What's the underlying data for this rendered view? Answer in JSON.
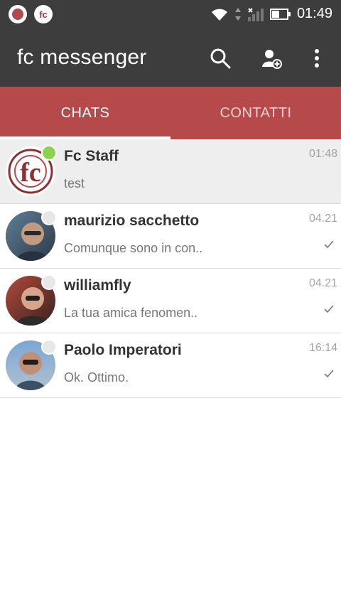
{
  "status_bar": {
    "time": "01:49"
  },
  "app_bar": {
    "title": "fc messenger",
    "actions": [
      "search-icon",
      "add-contact-icon",
      "overflow-menu-icon"
    ]
  },
  "tabs": [
    {
      "label": "CHATS",
      "active": true
    },
    {
      "label": "CONTATTI",
      "active": false
    }
  ],
  "colors": {
    "appbar": "#3d3d3d",
    "tabs": "#b64a4b",
    "online": "#8bd34e",
    "offline": "#e7e7e7"
  },
  "chats": [
    {
      "name": "Fc Staff",
      "preview": "test",
      "time": "01:48",
      "online": true,
      "highlight": true,
      "avatar": "fc-logo"
    },
    {
      "name": "maurizio sacchetto",
      "preview": "Comunque sono in con..",
      "time": "04.21",
      "online": false,
      "avatar": "person-photo"
    },
    {
      "name": "williamfly",
      "preview": "La tua amica fenomen..",
      "time": "04.21",
      "online": false,
      "avatar": "person-photo"
    },
    {
      "name": "Paolo Imperatori",
      "preview": "Ok. Ottimo.",
      "time": "16:14",
      "online": false,
      "avatar": "person-photo"
    }
  ]
}
